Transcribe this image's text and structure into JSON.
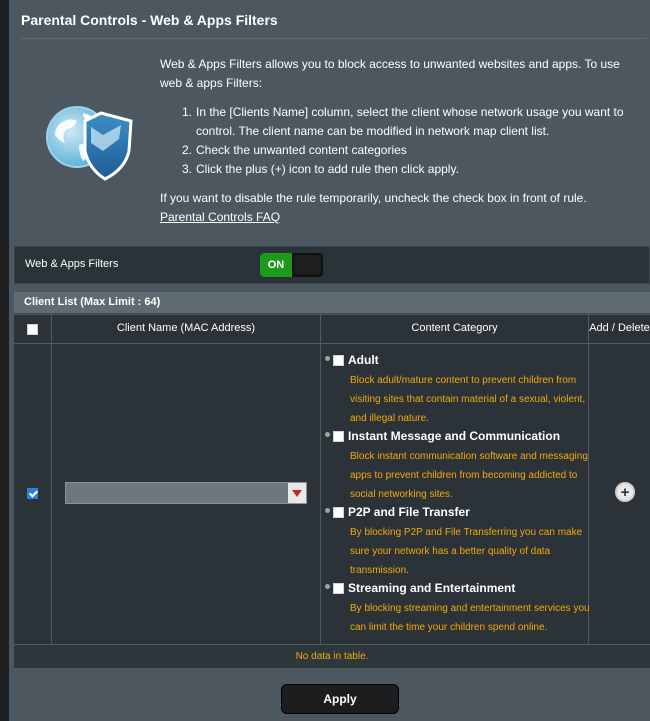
{
  "page": {
    "title": "Parental Controls - Web & Apps Filters"
  },
  "intro": {
    "description": "Web & Apps Filters allows you to block access to unwanted websites and apps. To use web & apps Filters:",
    "steps": [
      {
        "num": "1.",
        "text": "In the [Clients Name] column, select the client whose network usage you want to control. The client name can be modified in network map client list."
      },
      {
        "num": "2.",
        "text": "Check the unwanted content categories"
      },
      {
        "num": "3.",
        "text": "Click the plus (+) icon to add rule then click apply."
      }
    ],
    "disable_note": "If you want to disable the rule temporarily, uncheck the check box in front of rule.",
    "faq_link": "Parental Controls FAQ"
  },
  "filter_toggle": {
    "label": "Web & Apps Filters",
    "state": "ON"
  },
  "client_list": {
    "title": "Client List (Max Limit : 64)",
    "columns": {
      "client": "Client Name (MAC Address)",
      "category": "Content Category",
      "action": "Add / Delete"
    },
    "select_value": "",
    "categories": [
      {
        "name": "Adult",
        "desc": "Block adult/mature content to prevent children from visiting sites that contain material of a sexual, violent, and illegal nature."
      },
      {
        "name": "Instant Message and Communication",
        "desc": "Block instant communication software and messaging apps to prevent children from becoming addicted to social networking sites."
      },
      {
        "name": "P2P and File Transfer",
        "desc": "By blocking P2P and File Transferring you can make sure your network has a better quality of data transmission."
      },
      {
        "name": "Streaming and Entertainment",
        "desc": "By blocking streaming and entertainment services you can limit the time your children spend online."
      }
    ],
    "empty_text": "No data in table."
  },
  "apply_label": "Apply",
  "colors": {
    "panel": "#4c5760",
    "table": "#2b3338",
    "toggle_on": "#1c9a1c",
    "warning_text": "#f2a90d",
    "checkbox_checked": "#2d7fd8"
  }
}
